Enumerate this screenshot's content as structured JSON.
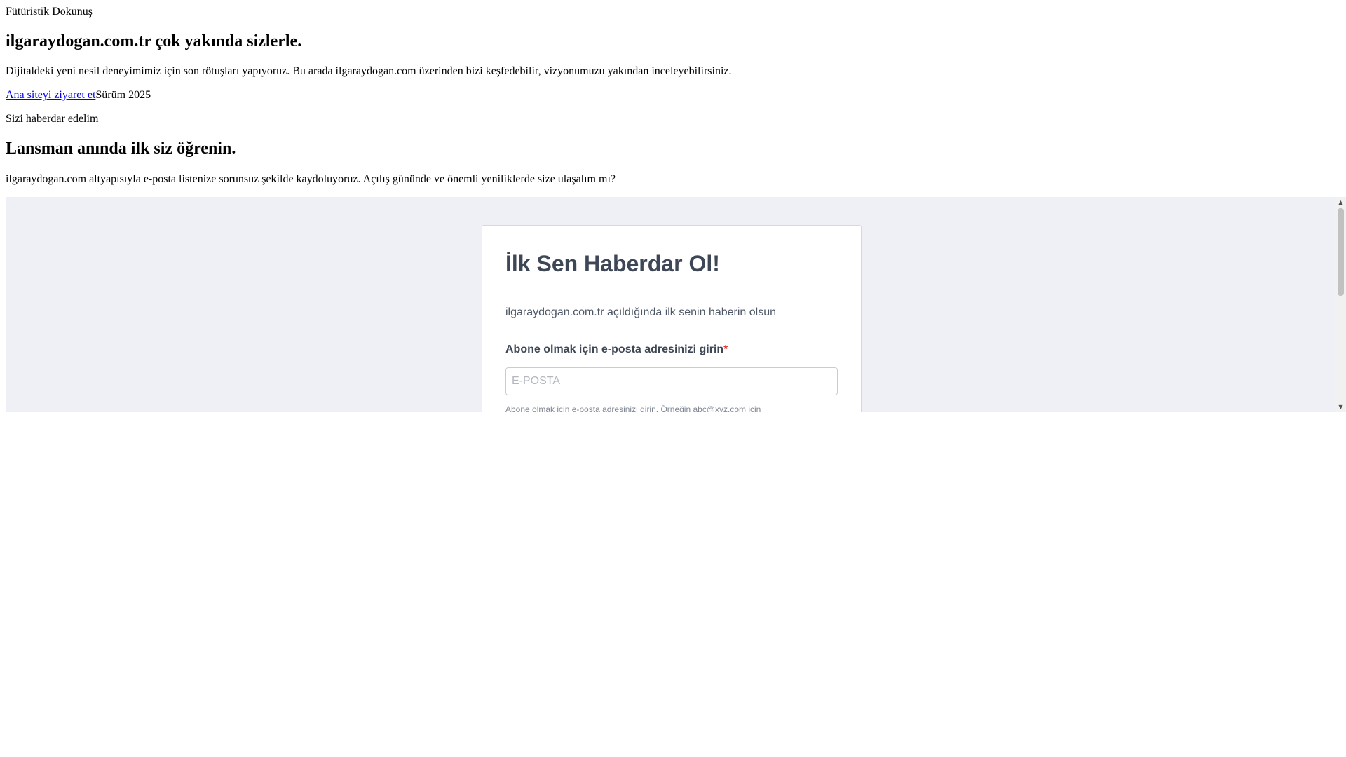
{
  "header": {
    "tagline": "Fütüristik Dokunuş",
    "title": "ilgaraydogan.com.tr çok yakında sizlerle.",
    "intro": "Dijitaldeki yeni nesil deneyimimiz için son rötuşları yapıyoruz. Bu arada ilgaraydogan.com üzerinden bizi keşfedebilir, vizyonumuzu yakından inceleyebilirsiniz.",
    "visit_link": "Ana siteyi ziyaret et",
    "version": "Sürüm 2025"
  },
  "notify": {
    "label": "Sizi haberdar edelim",
    "title": "Lansman anında ilk siz öğrenin.",
    "description": "ilgaraydogan.com altyapısıyla e-posta listenize sorunsuz şekilde kaydoluyoruz. Açılış gününde ve önemli yeniliklerde size ulaşalım mı?"
  },
  "form": {
    "title": "İlk Sen Haberdar Ol!",
    "subtitle": "ilgaraydogan.com.tr açıldığında ilk senin haberin olsun",
    "email_label": "Abone olmak için e-posta adresinizi girin",
    "required_mark": "*",
    "email_value": "",
    "email_placeholder": "E-POSTA",
    "help_text": "Abone olmak için e-posta adresinizi girin. Örneğin abc@xyz.com için"
  },
  "scrollbar": {
    "up_icon": "chevron-up-icon",
    "down_icon": "chevron-down-icon"
  },
  "colors": {
    "link": "#0000ee",
    "embed_background": "#eef0f5",
    "required": "#e23b3b"
  }
}
